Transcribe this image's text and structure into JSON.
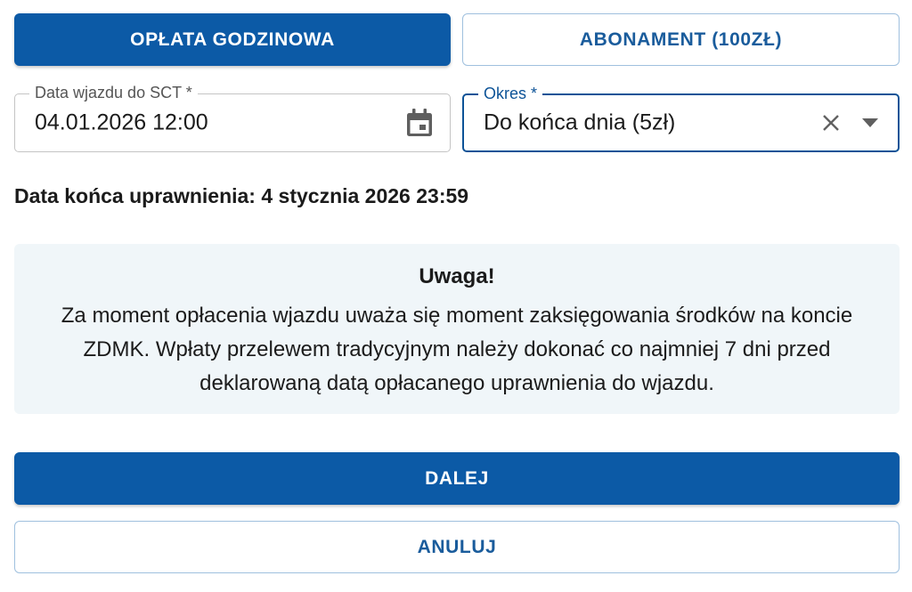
{
  "tabs": {
    "hourly_label": "OPŁATA GODZINOWA",
    "subscription_label": "ABONAMENT (100ZŁ)"
  },
  "entry_date": {
    "label": "Data wjazdu do SCT *",
    "value": "04.01.2026 12:00",
    "icon": "calendar-icon"
  },
  "period": {
    "label": "Okres *",
    "value": "Do końca dnia (5zł)",
    "clear_icon": "close-icon",
    "dropdown_icon": "caret-down-icon"
  },
  "permission_end": "Data końca uprawnienia: 4 stycznia 2026 23:59",
  "notice": {
    "title": "Uwaga!",
    "body": "Za moment opłacenia wjazdu uważa się moment zaksięgowania środków na koncie ZDMK. Wpłaty przelewem tradycyjnym należy dokonać co najmniej 7 dni przed deklarowaną datą opłacanego uprawnienia do wjazdu."
  },
  "actions": {
    "next_label": "DALEJ",
    "cancel_label": "ANULUJ"
  },
  "colors": {
    "primary": "#0c5aa6",
    "focus_border": "#0d5397",
    "notice_bg": "#f0f6f9"
  }
}
